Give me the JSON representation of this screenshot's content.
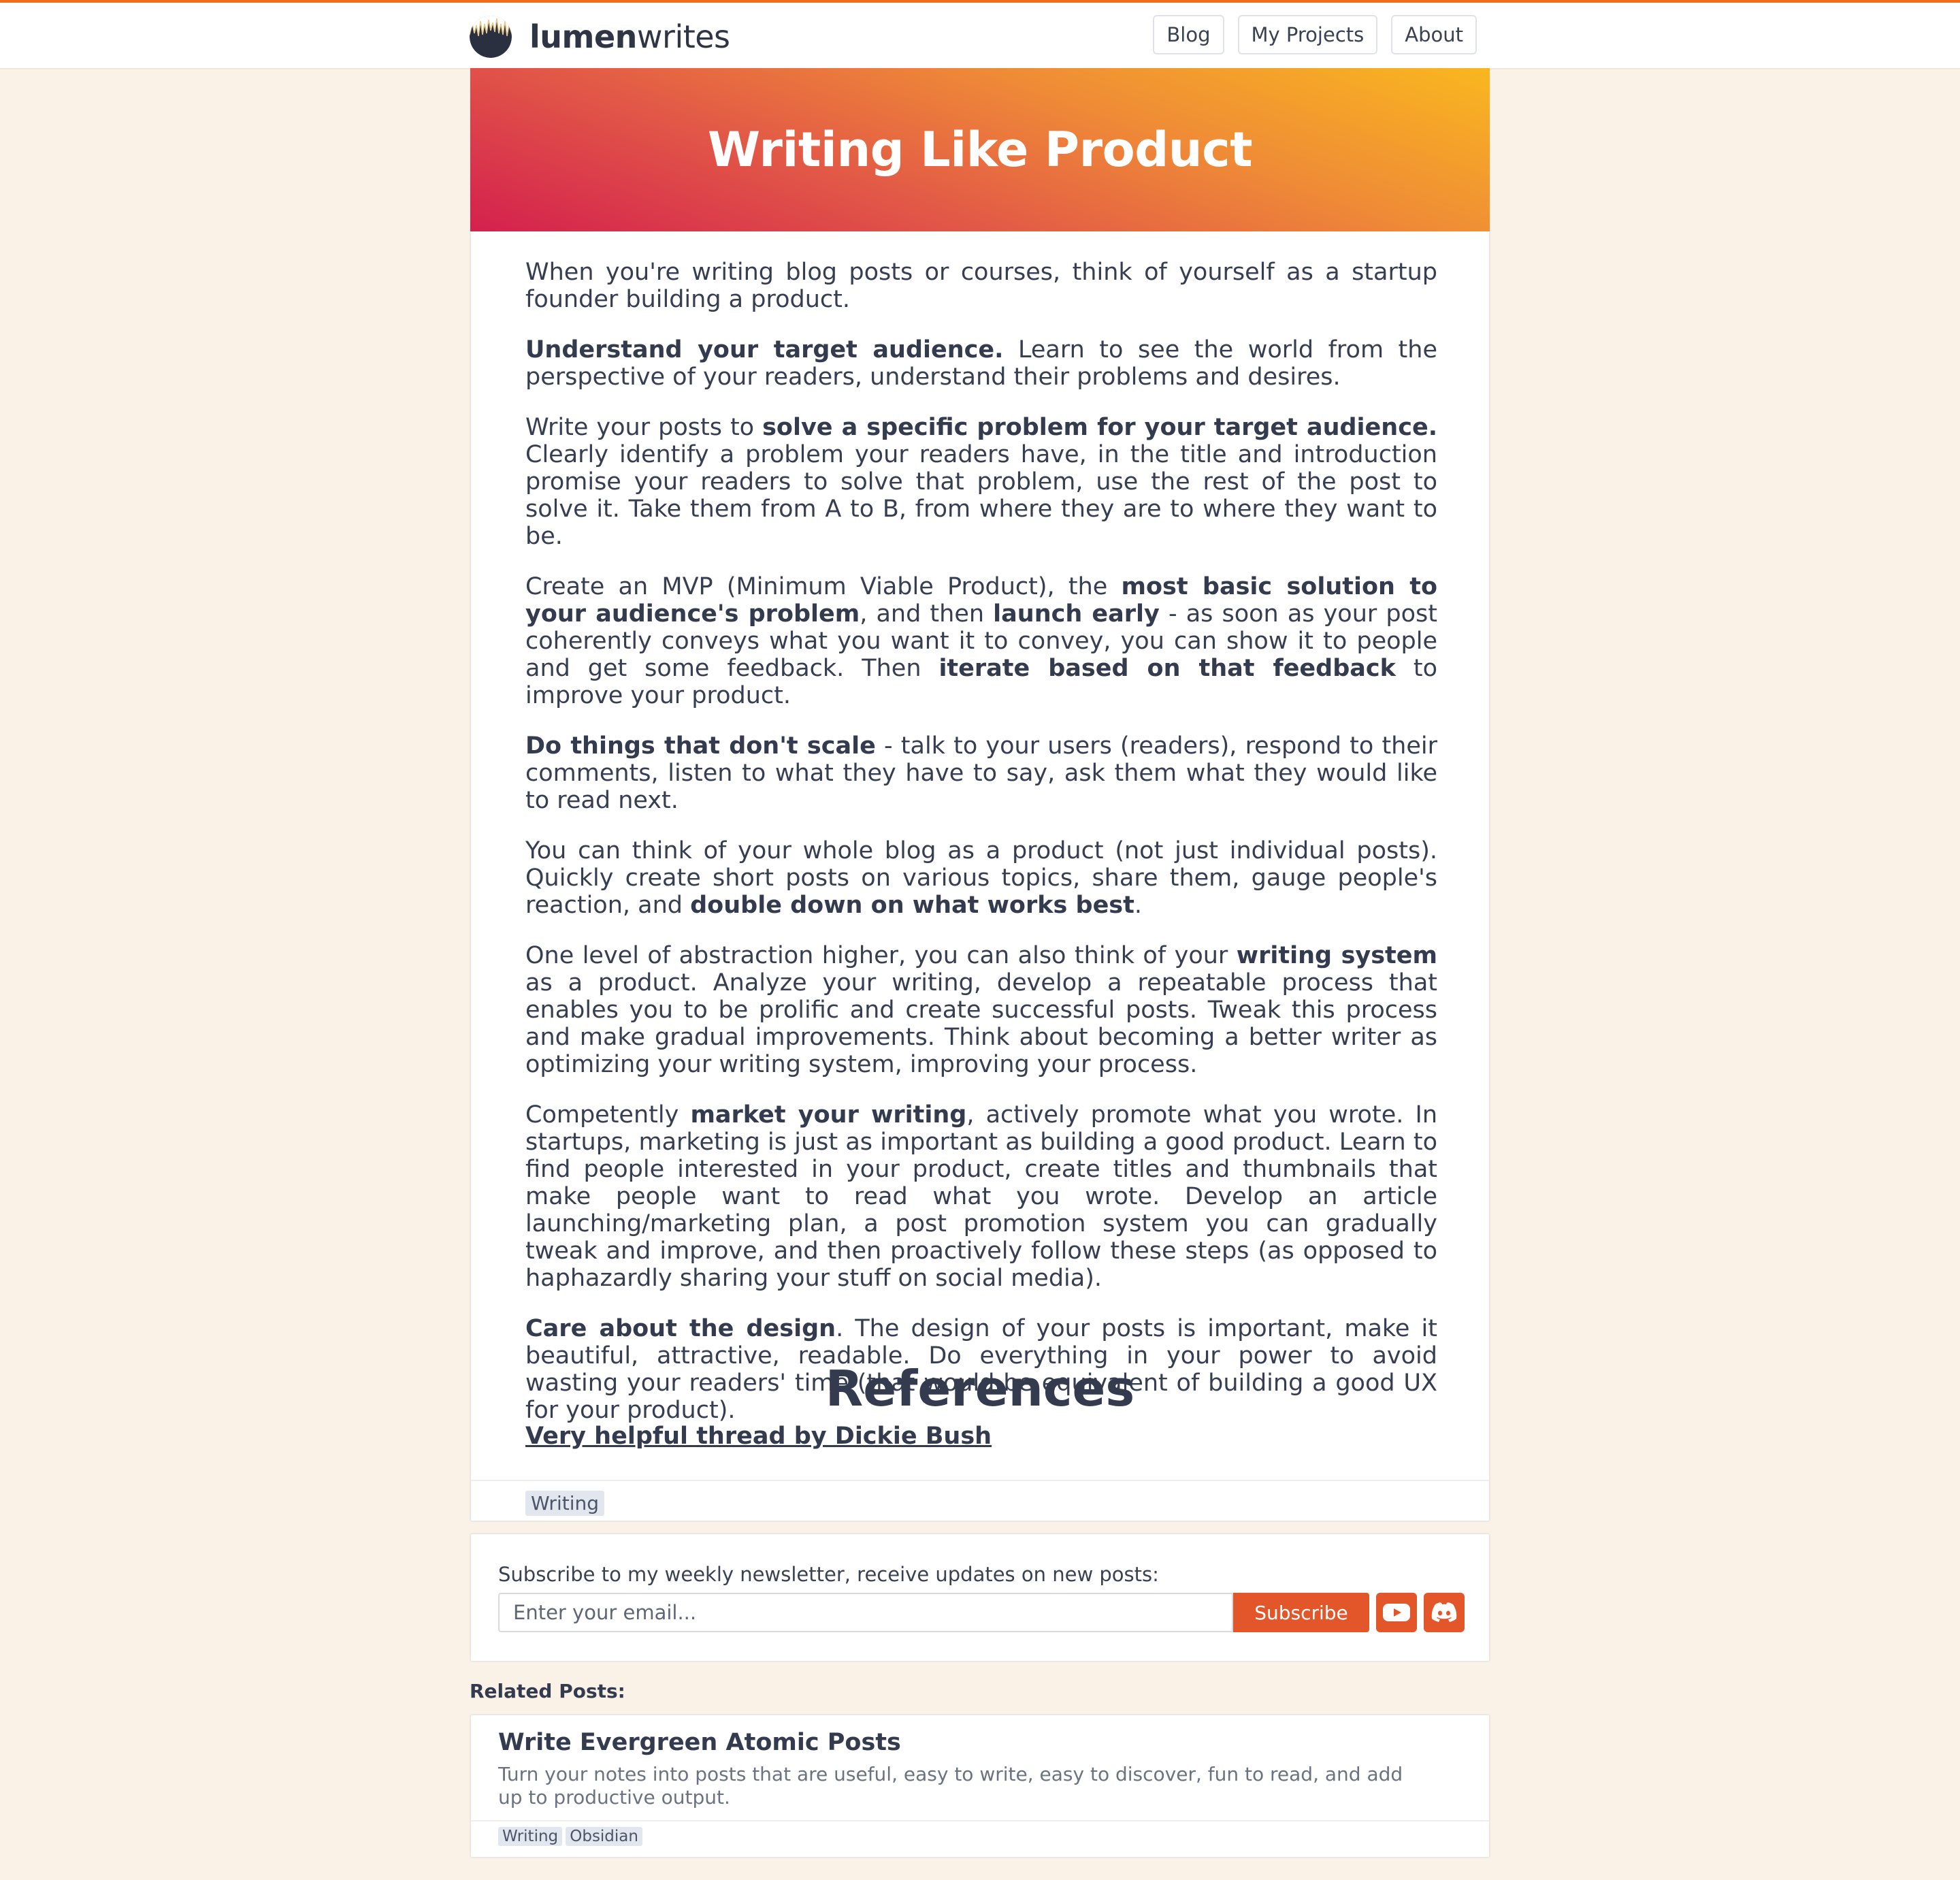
{
  "header": {
    "logo_bold": "lumen",
    "logo_light": "writes",
    "nav": [
      "Blog",
      "My Projects",
      "About"
    ]
  },
  "colors": {
    "accent": "#e2562a",
    "top_border": "#f26a1b",
    "page_bg": "#faf2e6",
    "hero_gradient": [
      "#f9b71f",
      "#ef8a37",
      "#e25847",
      "#d4204e"
    ]
  },
  "article": {
    "title": "Writing Like Product",
    "paragraphs": [
      [
        {
          "t": "When you're writing blog posts or courses, think of yourself as a startup founder building a product."
        }
      ],
      [
        {
          "t": "Understand your target audience.",
          "b": true
        },
        {
          "t": " Learn to see the world from the perspective of your readers, understand their problems and desires."
        }
      ],
      [
        {
          "t": "Write your posts to "
        },
        {
          "t": "solve a specific problem for your target audience.",
          "b": true
        },
        {
          "t": " Clearly identify a problem your readers have, in the title and introduction promise your readers to solve that problem, use the rest of the post to solve it. Take them from A to B, from where they are to where they want to be."
        }
      ],
      [
        {
          "t": "Create an MVP (Minimum Viable Product), the "
        },
        {
          "t": "most basic solution to your audience's problem",
          "b": true
        },
        {
          "t": ", and then "
        },
        {
          "t": "launch early",
          "b": true
        },
        {
          "t": " - as soon as your post coherently conveys what you want it to convey, you can show it to people and get some feedback. Then "
        },
        {
          "t": "iterate based on that feedback",
          "b": true
        },
        {
          "t": " to improve your product."
        }
      ],
      [
        {
          "t": "Do things that don't scale",
          "b": true
        },
        {
          "t": " - talk to your users (readers), respond to their comments, listen to what they have to say, ask them what they would like to read next."
        }
      ],
      [
        {
          "t": "You can think of your whole blog as a product (not just individual posts). Quickly create short posts on various topics, share them, gauge people's reaction, and "
        },
        {
          "t": "double down on what works best",
          "b": true
        },
        {
          "t": "."
        }
      ],
      [
        {
          "t": "One level of abstraction higher, you can also think of your "
        },
        {
          "t": "writing system",
          "b": true
        },
        {
          "t": " as a product. Analyze your writing, develop a repeatable process that enables you to be prolific and create successful posts. Tweak this process and make gradual improvements. Think about becoming a better writer as optimizing your writing system, improving your process."
        }
      ],
      [
        {
          "t": "Competently "
        },
        {
          "t": "market your writing",
          "b": true
        },
        {
          "t": ", actively promote what you wrote. In startups, marketing is just as important as building a good product. Learn to find people interested in your product, create titles and thumbnails that make people want to read what you wrote. Develop an article launching/marketing plan, a post promotion system you can gradually tweak and improve, and then proactively follow these steps (as opposed to haphazardly sharing your stuff on social media)."
        }
      ],
      [
        {
          "t": "Care about the design",
          "b": true
        },
        {
          "t": ". The design of your posts is important, make it beautiful, attractive, readable. Do everything in your power to avoid wasting your readers' time (that would be equivalent of building a good UX for your product)."
        }
      ]
    ],
    "references_title": "References",
    "reference_link": "Very helpful thread by Dickie Bush",
    "tags": [
      "Writing"
    ]
  },
  "newsletter": {
    "prompt": "Subscribe to my weekly newsletter, receive updates on new posts:",
    "placeholder": "Enter your email...",
    "button": "Subscribe",
    "icons": [
      "youtube-icon",
      "discord-icon"
    ]
  },
  "related": {
    "label": "Related Posts:",
    "posts": [
      {
        "title": "Write Evergreen Atomic Posts",
        "description": "Turn your notes into posts that are useful, easy to write, easy to discover, fun to read, and add up to productive output.",
        "tags": [
          "Writing",
          "Obsidian"
        ]
      }
    ]
  }
}
